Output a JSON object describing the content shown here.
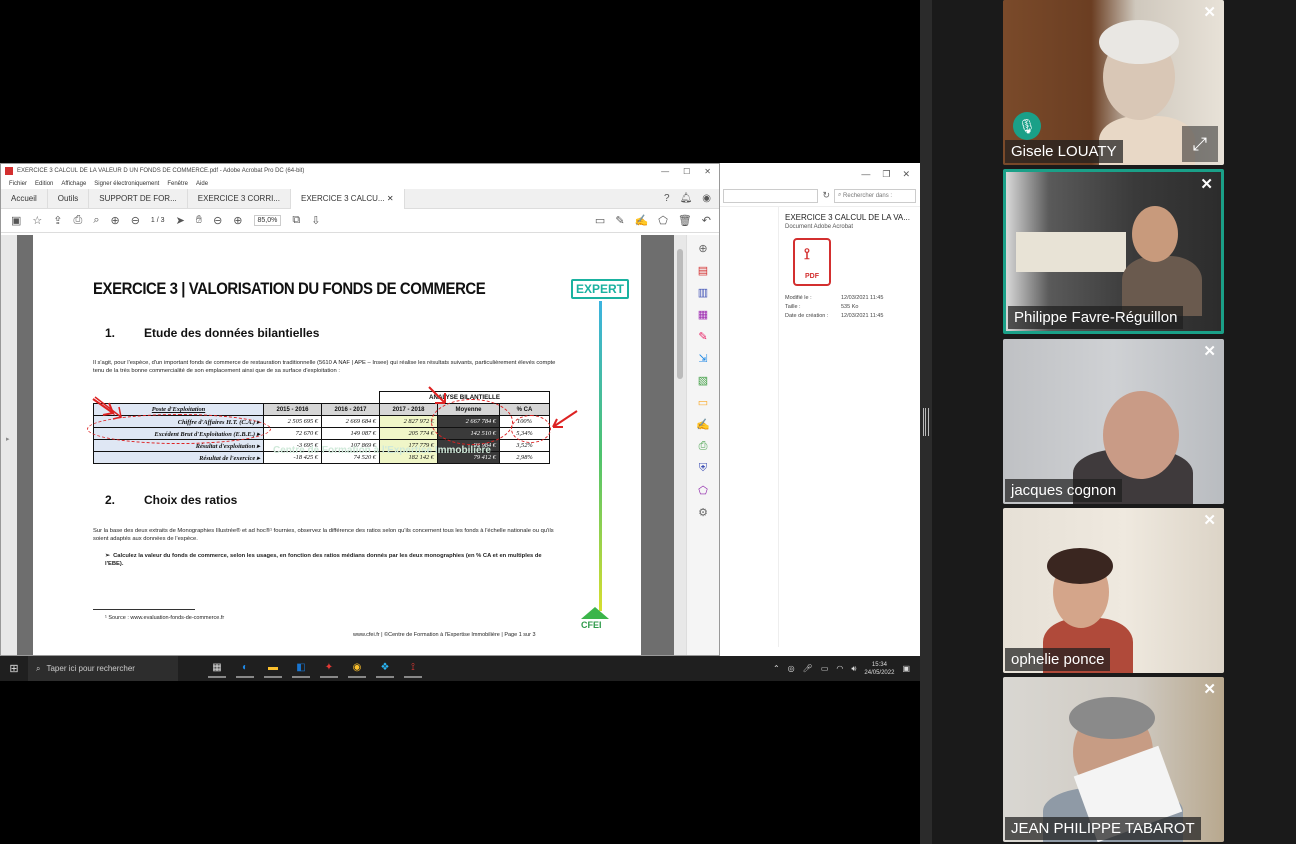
{
  "acrobat": {
    "window_title": "EXERCICE 3 CALCUL DE LA VALEUR D UN FONDS DE COMMERCE.pdf - Adobe Acrobat Pro DC (64-bit)",
    "menu": [
      "Fichier",
      "Edition",
      "Affichage",
      "Signer électroniquement",
      "Fenêtre",
      "Aide"
    ],
    "tabs": [
      "Accueil",
      "Outils",
      "SUPPORT DE FOR...",
      "EXERCICE 3 CORRI...",
      "EXERCICE 3 CALCU..."
    ],
    "page_current": "1",
    "page_total": "/ 3",
    "zoom": "85,0%"
  },
  "document": {
    "title": "EXERCICE 3 | VALORISATION DU FONDS DE COMMERCE",
    "badge": "EXPERT",
    "section1_num": "1.",
    "section1_title": "Etude des données bilantielles",
    "intro": "Il s'agit, pour l'espèce, d'un important fonds de commerce de restauration traditionnelle (5610 A NAF | APE – Insee) qui réalise les résultats suivants, particulièrement élevés compte tenu de la très bonne commercialité de son emplacement ainsi que de sa surface d'exploitation :",
    "table": {
      "title": "ANALYSE BILANTIELLE",
      "columns": [
        "Poste d'Exploitation",
        "2015 - 2016",
        "2016 - 2017",
        "2017 - 2018",
        "Moyenne",
        "% CA"
      ],
      "rows": [
        {
          "label": "Chiffre d'Affaires H.T. (C.A.)",
          "y1": "2 505 695 €",
          "y2": "2 669 684 €",
          "y3": "2 827 972 €",
          "avg": "2 667 784 €",
          "pct": "100%"
        },
        {
          "label": "Excédent Brut d'Exploitation (E.B.E.)",
          "y1": "72 670 €",
          "y2": "149 087 €",
          "y3": "205 774 €",
          "avg": "142 510 €",
          "pct": "5,34%"
        },
        {
          "label": "Résultat d'exploitation",
          "y1": "-3 695 €",
          "y2": "107 869 €",
          "y3": "177 779 €",
          "avg": "93 984 €",
          "pct": "3,52%"
        },
        {
          "label": "Résultat de l'exercice",
          "y1": "-18 425 €",
          "y2": "74 520 €",
          "y3": "182 142 €",
          "avg": "79 412 €",
          "pct": "2,98%"
        }
      ]
    },
    "watermark": "Centre de Formation à l'Expertise Immobilière",
    "section2_num": "2.",
    "section2_title": "Choix des ratios",
    "para2": "Sur la base des deux extraits de Monographies Illustrée® et ad hoc®¹ fournies, observez la différence des ratios selon qu'ils concernent tous les fonds à l'échelle nationale ou qu'ils soient adaptés aux données de l'espèce.",
    "bullet": "Calculez la valeur du fonds de commerce, selon les usages, en fonction des ratios médians donnés par les deux monographies (en % CA et en multiples de l'EBE).",
    "footnote": "¹ Source : www.evaluation-fonds-de-commerce.fr",
    "page_footer": "www.cfei.fr | ©Centre de Formation à l'Expertise Immobilière | Page 1 sur 3",
    "logo_text": "CFEI"
  },
  "explorer": {
    "search_placeholder": "Rechercher dans :",
    "file_name": "EXERCICE 3 CALCUL DE LA VA...",
    "file_type": "Document Adobe Acrobat",
    "pdf_label": "PDF",
    "meta": [
      {
        "k": "Modifié le :",
        "v": "12/03/2021 11:45"
      },
      {
        "k": "Taille :",
        "v": "535 Ko"
      },
      {
        "k": "Date de création :",
        "v": "12/03/2021 11:45"
      }
    ]
  },
  "taskbar": {
    "search_placeholder": "Taper ici pour rechercher",
    "time": "15:34",
    "date": "24/05/2022"
  },
  "participants": [
    {
      "name": "Gisele LOUATY"
    },
    {
      "name": "Philippe Favre-Réguillon"
    },
    {
      "name": "jacques cognon"
    },
    {
      "name": "ophelie ponce"
    },
    {
      "name": "JEAN PHILIPPE TABAROT"
    }
  ],
  "colors": {
    "active_speaker": "#1aa088",
    "annotation": "#d22222",
    "acrobat_red": "#d32f2f"
  }
}
